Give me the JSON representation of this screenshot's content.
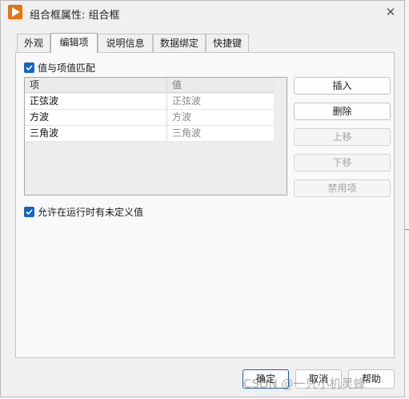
{
  "window": {
    "title": "组合框属性: 组合框",
    "close_glyph": "✕"
  },
  "tabs": [
    {
      "label": "外观",
      "active": false
    },
    {
      "label": "编辑项",
      "active": true
    },
    {
      "label": "说明信息",
      "active": false
    },
    {
      "label": "数据绑定",
      "active": false
    },
    {
      "label": "快捷键",
      "active": false
    }
  ],
  "options": {
    "values_match_items": {
      "label": "值与项值匹配",
      "checked": true
    },
    "allow_undefined": {
      "label": "允许在运行时有未定义值",
      "checked": true
    }
  },
  "table": {
    "headers": [
      "项",
      "值"
    ],
    "rows": [
      [
        "正弦波",
        "正弦波"
      ],
      [
        "方波",
        "方波"
      ],
      [
        "三角波",
        "三角波"
      ]
    ]
  },
  "side_buttons": {
    "insert": {
      "label": "插入",
      "enabled": true
    },
    "delete": {
      "label": "删除",
      "enabled": true
    },
    "move_up": {
      "label": "上移",
      "enabled": false
    },
    "move_down": {
      "label": "下移",
      "enabled": false
    },
    "disable_item": {
      "label": "禁用项",
      "enabled": false
    }
  },
  "footer": {
    "ok": "确定",
    "cancel": "取消",
    "help": "帮助"
  },
  "watermark": "CSDN @一只小机灵蜂",
  "colors": {
    "accent": "#1565c0",
    "app_icon": "#e8720c",
    "disabled_text": "#a4a4a4"
  }
}
